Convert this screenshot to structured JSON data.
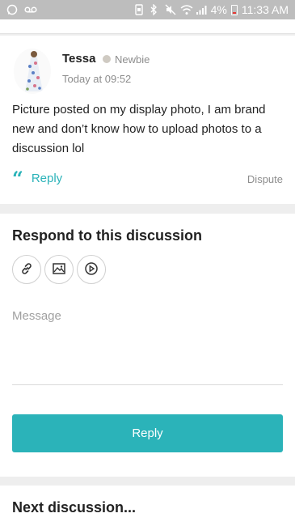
{
  "status_bar": {
    "battery_percent": "4%",
    "time": "11:33 AM",
    "left_icons": [
      "whatsapp-icon",
      "voicemail-icon"
    ],
    "right_icons": [
      "sync-icon",
      "bluetooth-icon",
      "mute-icon",
      "wifi-icon",
      "signal-icon",
      "battery-icon"
    ],
    "battery_level": 0.04,
    "bar_color": "#bdbdbd"
  },
  "post": {
    "author": "Tessa",
    "rank": "Newbie",
    "timestamp": "Today at 09:52",
    "body": "Picture posted on my display photo, I am brand new and don’t know how to upload photos to a discussion lol",
    "reply_label": "Reply",
    "dispute_label": "Dispute"
  },
  "respond": {
    "title": "Respond to this discussion",
    "attach_buttons": [
      "link-icon",
      "image-icon",
      "video-icon"
    ],
    "message_placeholder": "Message",
    "message_value": "",
    "submit_label": "Reply"
  },
  "next": {
    "title": "Next discussion..."
  },
  "colors": {
    "accent": "#2bb3b9",
    "muted_text": "#8d8d8d",
    "background": "#eeeeee",
    "rank_dot": "#cfcac2"
  }
}
